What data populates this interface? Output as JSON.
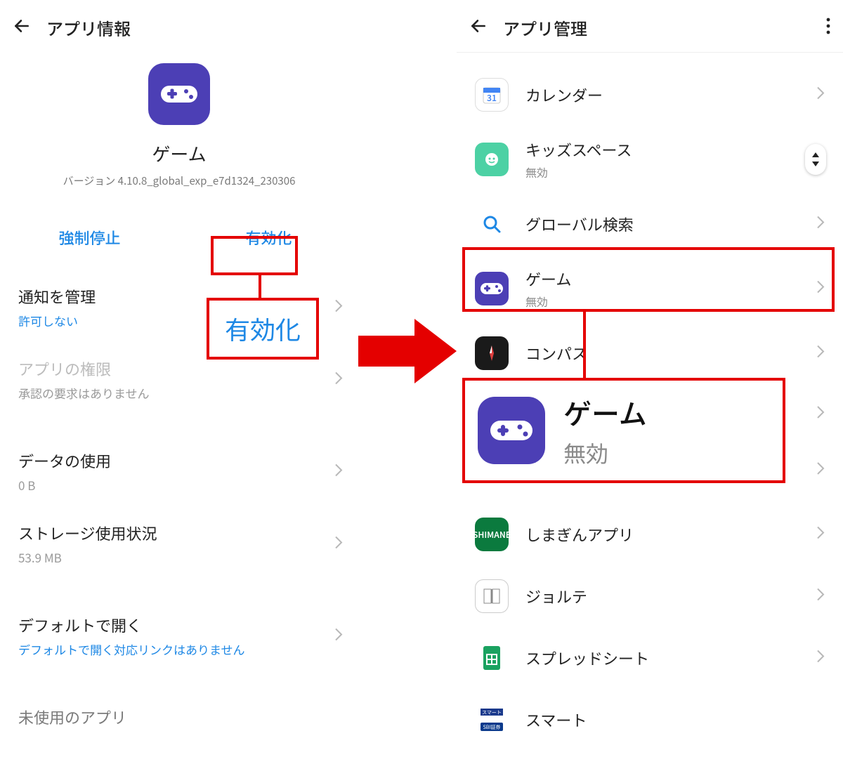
{
  "left": {
    "title": "アプリ情報",
    "app_name": "ゲーム",
    "version": "バージョン 4.10.8_global_exp_e7d1324_230306",
    "force_stop": "強制停止",
    "enable": "有効化",
    "rows": {
      "notify_title": "通知を管理",
      "notify_sub": "許可しない",
      "perm_title": "アプリの権限",
      "perm_sub": "承認の要求はありません",
      "data_title": "データの使用",
      "data_sub": "0 B",
      "storage_title": "ストレージ使用状況",
      "storage_sub": "53.9 MB",
      "default_title": "デフォルトで開く",
      "default_sub": "デフォルトで開く対応リンクはありません",
      "unused_title": "未使用のアプリ"
    },
    "callout_big": "有効化"
  },
  "right": {
    "title": "アプリ管理",
    "apps": [
      {
        "name": "カレンダー",
        "sub": ""
      },
      {
        "name": "キッズスペース",
        "sub": "無効"
      },
      {
        "name": "グローバル検索",
        "sub": ""
      },
      {
        "name": "ゲーム",
        "sub": "無効"
      },
      {
        "name": "コンパス",
        "sub": ""
      },
      {
        "name": "しまぎんアプリ",
        "sub": ""
      },
      {
        "name": "ジョルテ",
        "sub": ""
      },
      {
        "name": "スプレッドシート",
        "sub": ""
      },
      {
        "name": "スマート",
        "sub": ""
      }
    ],
    "callout": {
      "name": "ゲーム",
      "sub": "無効"
    }
  }
}
